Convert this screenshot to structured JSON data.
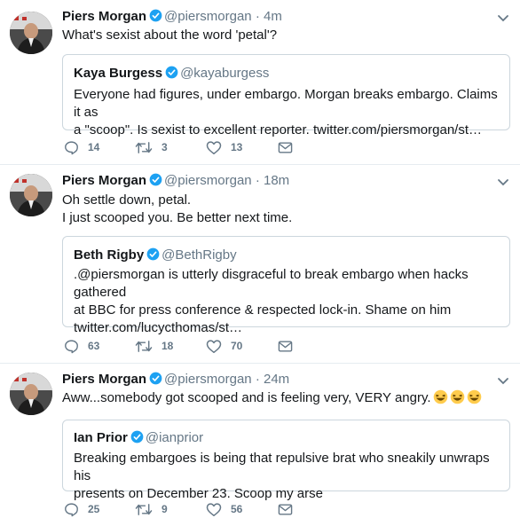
{
  "tweets": [
    {
      "name": "Piers Morgan",
      "handle": "@piersmorgan",
      "separator": "·",
      "time": "4m",
      "lines": [
        "What's sexist about the word 'petal'?"
      ],
      "quote": {
        "name": "Kaya Burgess",
        "handle": "@kayaburgess",
        "lines": [
          "Everyone had figures, under embargo. Morgan breaks embargo. Claims it as",
          "a \"scoop\". Is sexist to excellent reporter. twitter.com/piersmorgan/st…"
        ]
      },
      "replies": "14",
      "retweets": "3",
      "likes": "13"
    },
    {
      "name": "Piers Morgan",
      "handle": "@piersmorgan",
      "separator": "·",
      "time": "18m",
      "lines": [
        "Oh settle down, petal.",
        "I just scooped you. Be better next time."
      ],
      "quote": {
        "name": "Beth Rigby",
        "handle": "@BethRigby",
        "lines": [
          ".@piersmorgan is utterly disgraceful to break embargo when hacks gathered",
          "at BBC for press conference & respected lock-in. Shame on him",
          "twitter.com/lucycthomas/st…"
        ]
      },
      "replies": "63",
      "retweets": "18",
      "likes": "70"
    },
    {
      "name": "Piers Morgan",
      "handle": "@piersmorgan",
      "separator": "·",
      "time": "24m",
      "lines": [
        "Aww...somebody got scooped and is feeling very, VERY angry."
      ],
      "emoji": "laughing-face-emoji",
      "quote": {
        "name": "Ian Prior",
        "handle": "@ianprior",
        "lines": [
          "Breaking embargoes is being that repulsive brat who sneakily unwraps his",
          "presents on December 23. Scoop my arse"
        ]
      },
      "replies": "25",
      "retweets": "9",
      "likes": "56"
    }
  ],
  "icons": {
    "verified": "verified-badge-icon",
    "caret": "chevron-down-icon",
    "reply": "reply-icon",
    "retweet": "retweet-icon",
    "like": "heart-icon",
    "dm": "envelope-icon"
  },
  "colors": {
    "name": "#14171a",
    "muted": "#657786",
    "verified": "#1da1f2",
    "border": "#ccd6dd",
    "divider": "#e6ecf0",
    "emoji": "#ffcc4d"
  }
}
